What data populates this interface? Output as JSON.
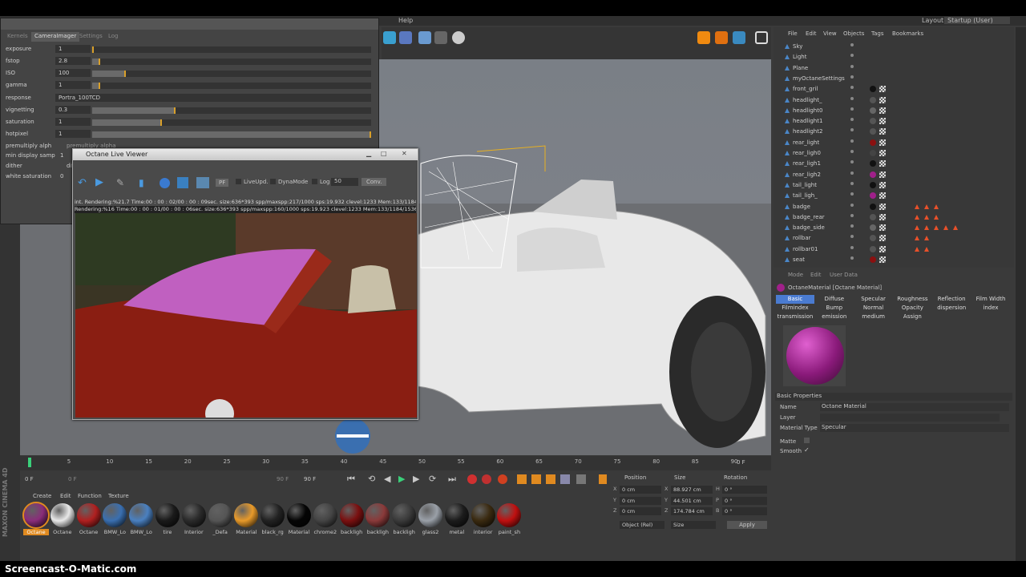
{
  "menubar": {
    "help": "Help",
    "layout_label": "Layout:",
    "layout_value": "Startup (User)"
  },
  "camera_window": {
    "tabs": [
      "Kernels",
      "CameraImager",
      "Settings",
      "Log"
    ],
    "active_tab": "CameraImager",
    "rows": [
      {
        "label": "exposure",
        "value": "1",
        "fill": 0.0
      },
      {
        "label": "fstop",
        "value": "2.8",
        "fill": 0.03
      },
      {
        "label": "ISO",
        "value": "100",
        "fill": 0.12
      },
      {
        "label": "gamma",
        "value": "1",
        "fill": 0.03
      },
      {
        "label": "vignetting",
        "value": "0.3",
        "fill": 0.3
      },
      {
        "label": "saturation",
        "value": "1",
        "fill": 0.25
      },
      {
        "label": "hotpixel",
        "value": "1",
        "fill": 1.0
      }
    ],
    "response_label": "response",
    "response_value": "Portra_100TCD",
    "premultiply_label": "premultiply alph",
    "premultiply_check": "premultiply alpha",
    "min_display_label": "min display samp",
    "min_display_value": "1",
    "dither_label": "dither",
    "dither_check": "dith",
    "white_sat_label": "white saturation",
    "white_sat_value": "0"
  },
  "live_viewer": {
    "title": "Octane Live Viewer",
    "pf": "PF",
    "liveupd": "LiveUpd.",
    "dynamode": "DynaMode",
    "log": "Log",
    "log_value": "50",
    "conv": "Conv.",
    "status1": "int. Rendering:%21.7 Time:00 : 00 : 02/00 : 00 : 09sec. size:636*393 spp/maxspp:217/1000 sps:19.932 clevel:1233 Mem:133/1184",
    "status2": "Rendering:%16 Time:00 : 00 : 01/00 : 00 : 06sec. size:636*393 spp/maxspp:160/1000 sps:19.923 clevel:1233 Mem:133/1184/1536"
  },
  "object_manager": {
    "menu": [
      "File",
      "Edit",
      "View",
      "Objects",
      "Tags",
      "Bookmarks"
    ],
    "objects": [
      "Sky",
      "Light",
      "Plane",
      "myOctaneSettings",
      "front_gril",
      "headlight_",
      "headlight0",
      "headlight1",
      "headlight2",
      "rear_light",
      "rear_ligh0",
      "rear_ligh1",
      "rear_ligh2",
      "tail_light",
      "tail_ligh_",
      "badge",
      "badge_rear",
      "badge_side",
      "rollbar",
      "rollbar01",
      "seat"
    ]
  },
  "attributes": {
    "menu": [
      "Mode",
      "Edit",
      "User Data"
    ],
    "material_title": "OctaneMaterial [Octane Material]",
    "tabs_row1": [
      "Basic",
      "Diffuse",
      "Specular",
      "Roughness",
      "Reflection",
      "Film Width"
    ],
    "tabs_row2": [
      "Filmindex",
      "Bump",
      "Normal",
      "Opacity",
      "dispersion",
      "index"
    ],
    "tabs_row3": [
      "transmission",
      "emission",
      "medium",
      "Assign"
    ],
    "section": "Basic Properties",
    "name_label": "Name",
    "name_value": "Octane Material",
    "layer_label": "Layer",
    "type_label": "Material Type",
    "type_value": "Specular",
    "matte_label": "Matte",
    "smooth_label": "Smooth",
    "smooth_check": "✓"
  },
  "timeline": {
    "ticks": [
      "0",
      "5",
      "10",
      "15",
      "20",
      "25",
      "30",
      "35",
      "40",
      "45",
      "50",
      "55",
      "60",
      "65",
      "70",
      "75",
      "80",
      "85",
      "90"
    ],
    "end_frame": "0 F",
    "start_field": "0 F",
    "mid_field": "0 F",
    "end_field": "90 F",
    "end_field2": "90 F"
  },
  "material_manager": {
    "menu": [
      "Create",
      "Edit",
      "Function",
      "Texture"
    ],
    "materials": [
      {
        "label": "Octane",
        "color": "#8a2d7a"
      },
      {
        "label": "Octane",
        "color": "#e8e8e8"
      },
      {
        "label": "Octane",
        "color": "#b02020"
      },
      {
        "label": "BMW_Lo",
        "color": "#3a6fb0"
      },
      {
        "label": "BMW_Lo",
        "color": "#4a80c0"
      },
      {
        "label": "tire",
        "color": "#1a1a1a"
      },
      {
        "label": "Interior",
        "color": "#2a2a2a"
      },
      {
        "label": "_Defa",
        "color": "#555555"
      },
      {
        "label": "Material",
        "color": "#e89a2a"
      },
      {
        "label": "black_rg",
        "color": "#222222"
      },
      {
        "label": "Material",
        "color": "#050505"
      },
      {
        "label": "chrome2",
        "color": "#444444"
      },
      {
        "label": "backligh",
        "color": "#7a1010"
      },
      {
        "label": "backligh",
        "color": "#8a3a3a"
      },
      {
        "label": "backligh",
        "color": "#3a3a3a"
      },
      {
        "label": "glass2",
        "color": "#9aa0a8"
      },
      {
        "label": "metal",
        "color": "#1c1c1c"
      },
      {
        "label": "interior",
        "color": "#3a2a10"
      },
      {
        "label": "paint_sh",
        "color": "#c01010"
      }
    ]
  },
  "coordinates": {
    "headers": [
      "Position",
      "Size",
      "Rotation"
    ],
    "rows": [
      {
        "axis": "X",
        "pos": "0 cm",
        "saxis": "X",
        "size": "88.927 cm",
        "raxis": "H",
        "rot": "0 °"
      },
      {
        "axis": "Y",
        "pos": "0 cm",
        "saxis": "Y",
        "size": "44.501 cm",
        "raxis": "P",
        "rot": "0 °"
      },
      {
        "axis": "Z",
        "pos": "0 cm",
        "saxis": "Z",
        "size": "174.784 cm",
        "raxis": "B",
        "rot": "0 °"
      }
    ],
    "mode": "Object (Rel)",
    "size_mode": "Size",
    "apply": "Apply"
  },
  "branding": {
    "maxon": "MAXON CINEMA 4D",
    "watermark": "Screencast-O-Matic.com"
  },
  "colors": {
    "accent": "#4a7bd0",
    "bg": "#3a3a3a",
    "panel": "#383838"
  }
}
